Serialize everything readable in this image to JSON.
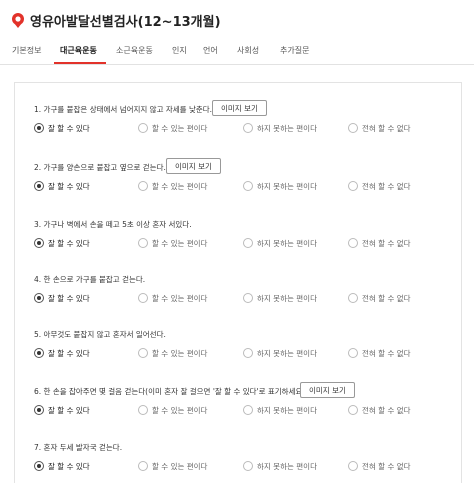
{
  "app": {
    "title": "영유아발달선별검사(12~13개월)"
  },
  "tabs": [
    {
      "label": "기본정보"
    },
    {
      "label": "대근육운동",
      "active": true
    },
    {
      "label": "소근육운동"
    },
    {
      "label": "인지"
    },
    {
      "label": "언어"
    },
    {
      "label": "사회성"
    },
    {
      "label": "추가질문"
    }
  ],
  "image_button_label": "이미지 보기",
  "options": [
    "잘 할 수 있다",
    "할 수 있는 편이다",
    "하지 못하는 편이다",
    "전혀 할 수 없다"
  ],
  "questions": [
    {
      "text": "1. 가구를 붙잡은 상태에서 넘어지지 않고 자세를 낮춘다.",
      "has_image": true,
      "selected": 0
    },
    {
      "text": "2. 가구를 양손으로 붙잡고 옆으로 걷는다.",
      "has_image": true,
      "selected": 0
    },
    {
      "text": "3. 가구나 벽에서 손을 떼고 5초 이상 혼자 서있다.",
      "has_image": false,
      "selected": 0
    },
    {
      "text": "4. 한 손으로 가구를 붙잡고 걷는다.",
      "has_image": false,
      "selected": 0
    },
    {
      "text": "5. 아무것도 붙잡지 않고 혼자서 일어선다.",
      "has_image": false,
      "selected": 0
    },
    {
      "text": "6. 한 손을 잡아주면 몇 걸음 걷는다(이미 혼자 잘 걸으면 '잘 할 수 있다'로 표기하세요).",
      "has_image": true,
      "selected": 0
    },
    {
      "text": "7. 혼자 두세 발자국 걷는다.",
      "has_image": false,
      "selected": 0
    }
  ],
  "colors": {
    "accent": "#e2322a",
    "border": "#e3e3e3"
  }
}
